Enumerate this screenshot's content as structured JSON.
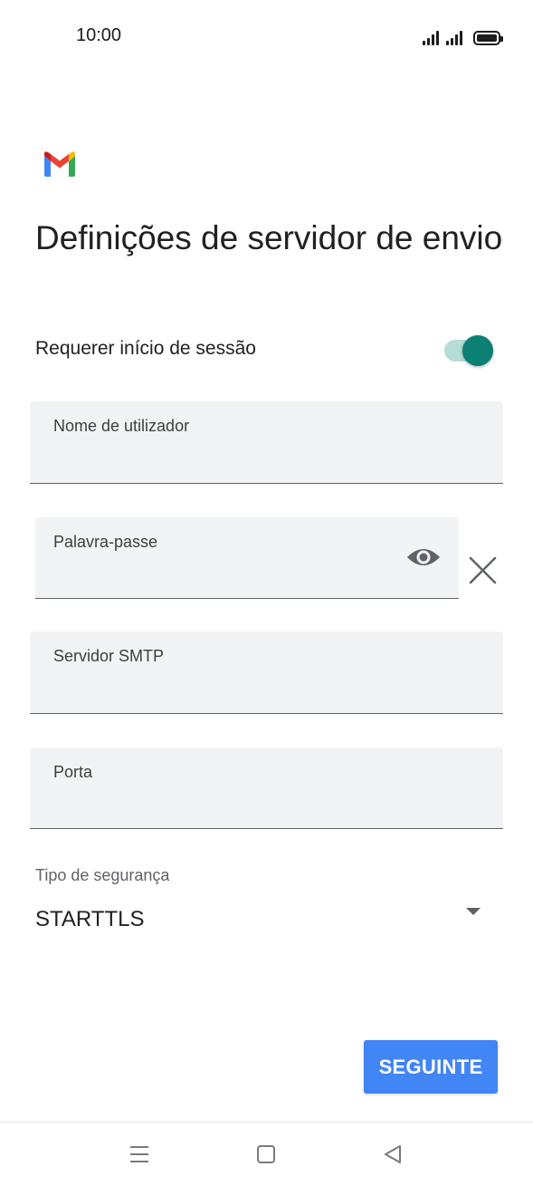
{
  "status_bar": {
    "time": "10:00"
  },
  "app": {
    "logo_icon": "gmail-logo",
    "title": "Definições de servidor de envio"
  },
  "require_login": {
    "label": "Requerer início de sessão",
    "enabled": true
  },
  "fields": {
    "username": {
      "label": "Nome de utilizador",
      "value": ""
    },
    "password": {
      "label": "Palavra-passe",
      "value": ""
    },
    "smtp_server": {
      "label": "Servidor SMTP",
      "value": ""
    },
    "port": {
      "label": "Porta",
      "value": ""
    }
  },
  "security": {
    "label": "Tipo de segurança",
    "selected": "STARTTLS"
  },
  "actions": {
    "next_label": "SEGUINTE"
  },
  "colors": {
    "accent_blue": "#4285f4",
    "toggle_thumb": "#0b8073",
    "toggle_track": "#b5dcd7",
    "field_background": "#f1f3f4"
  },
  "navigation": {
    "icons": [
      "menu-icon",
      "home-icon",
      "back-icon"
    ]
  }
}
